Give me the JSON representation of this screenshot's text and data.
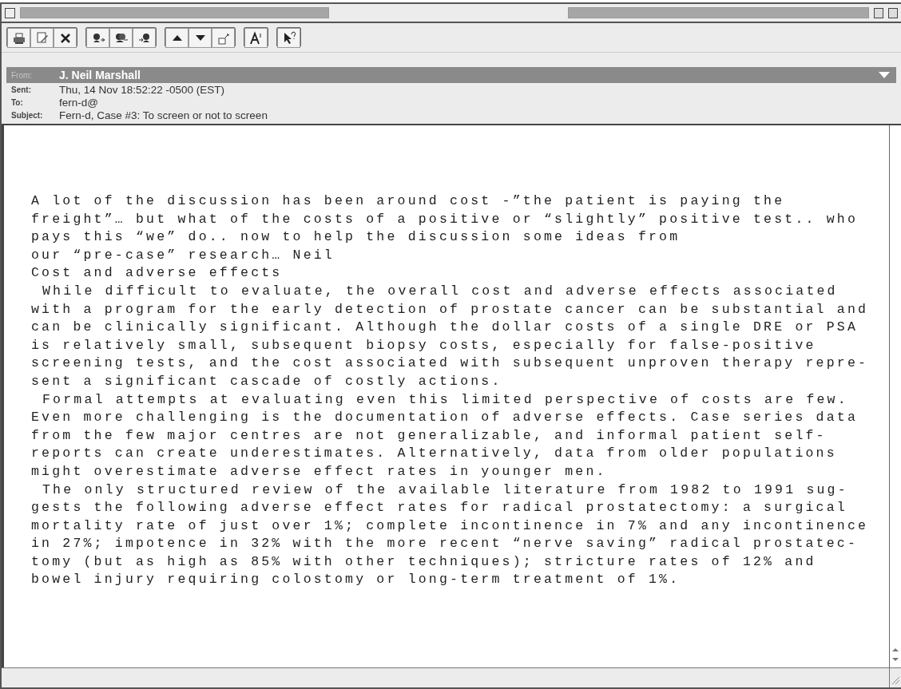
{
  "header": {
    "from": {
      "label": "From:",
      "value": "J. Neil Marshall"
    },
    "fields": [
      {
        "label": "Sent:",
        "value": "Thu, 14 Nov 18:52:22 -0500 (EST)"
      },
      {
        "label": "To:",
        "value": "fern-d@"
      },
      {
        "label": "Subject:",
        "value": "Fern-d, Case #3: To screen or not to screen"
      }
    ]
  },
  "body": [
    {
      "kind": "plain",
      "lines": [
        "A lot of the discussion has been around cost -”the patient is paying the",
        "freight”… but what of the costs of a positive or “slightly” positive test.. who",
        "pays this “we” do.. now to help the discussion some ideas from",
        "our “pre-case” research… Neil"
      ]
    },
    {
      "kind": "plain",
      "lines": [
        "Cost and adverse effects"
      ]
    },
    {
      "kind": "indented",
      "lines": [
        "While difficult to evaluate, the overall cost and adverse effects associated",
        "with a program for the early detection of prostate cancer can be substantial and",
        "can be clinically significant. Although the dollar costs of a single DRE or PSA",
        "is relatively small, subsequent biopsy costs, especially for false-positive",
        "screening tests, and the cost associated with subsequent unproven therapy repre-",
        "sent a significant cascade of costly actions."
      ]
    },
    {
      "kind": "indented",
      "lines": [
        "Formal attempts at evaluating even this limited perspective of costs are few.",
        "Even more challenging is the documentation of adverse effects. Case series data",
        "from the few major centres are not generalizable, and informal patient self-",
        "reports can create underestimates. Alternatively, data from older populations",
        "might overestimate adverse effect rates in younger men."
      ]
    },
    {
      "kind": "indented",
      "lines": [
        "The only structured review of the available literature from 1982 to 1991 sug-",
        "gests the following adverse effect rates for radical prostatectomy: a surgical",
        "mortality rate of just over 1%; complete incontinence in 7% and any incontinence",
        "in 27%; impotence in 32% with the more recent “nerve saving” radical prostatec-",
        "tomy (but as high as 85% with other techniques); stricture rates of 12% and",
        "bowel injury requiring colostomy or long-term treatment of 1%."
      ]
    }
  ]
}
